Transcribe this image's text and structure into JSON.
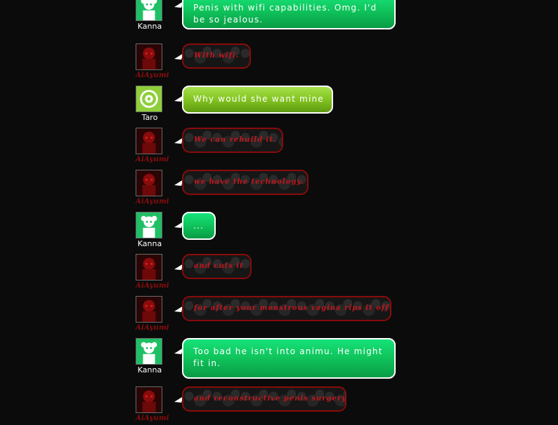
{
  "users": {
    "kanna": {
      "name": "Kanna",
      "avatar_icon": "kanna-avatar-icon",
      "bubble_color": "#10c65d"
    },
    "taro": {
      "name": "Taro",
      "avatar_icon": "taro-avatar-icon",
      "bubble_color": "#86c825"
    },
    "aiayumi": {
      "name": "AiAyumi",
      "avatar_icon": "aiayumi-avatar-icon",
      "bubble_color": "#8a0b0b"
    }
  },
  "messages": [
    {
      "user": "Kanna",
      "text": "Penis with wifi capabilities. Omg. I'd",
      "text2": "be so jealous."
    },
    {
      "user": "AiAyumi",
      "text": "With wifi."
    },
    {
      "user": "Taro",
      "text": "Why would she want mine"
    },
    {
      "user": "AiAyumi",
      "text": "We can rebuild it."
    },
    {
      "user": "AiAyumi",
      "text": "we have the technology."
    },
    {
      "user": "Kanna",
      "text": "..."
    },
    {
      "user": "AiAyumi",
      "text": "and cuts it"
    },
    {
      "user": "AiAyumi",
      "text": "for after your monstrous vagina rips it off"
    },
    {
      "user": "Kanna",
      "text": "Too bad he isn't into animu. He might",
      "text2": "fit in."
    },
    {
      "user": "AiAyumi",
      "text": "and reconstructive penis surgery"
    }
  ]
}
